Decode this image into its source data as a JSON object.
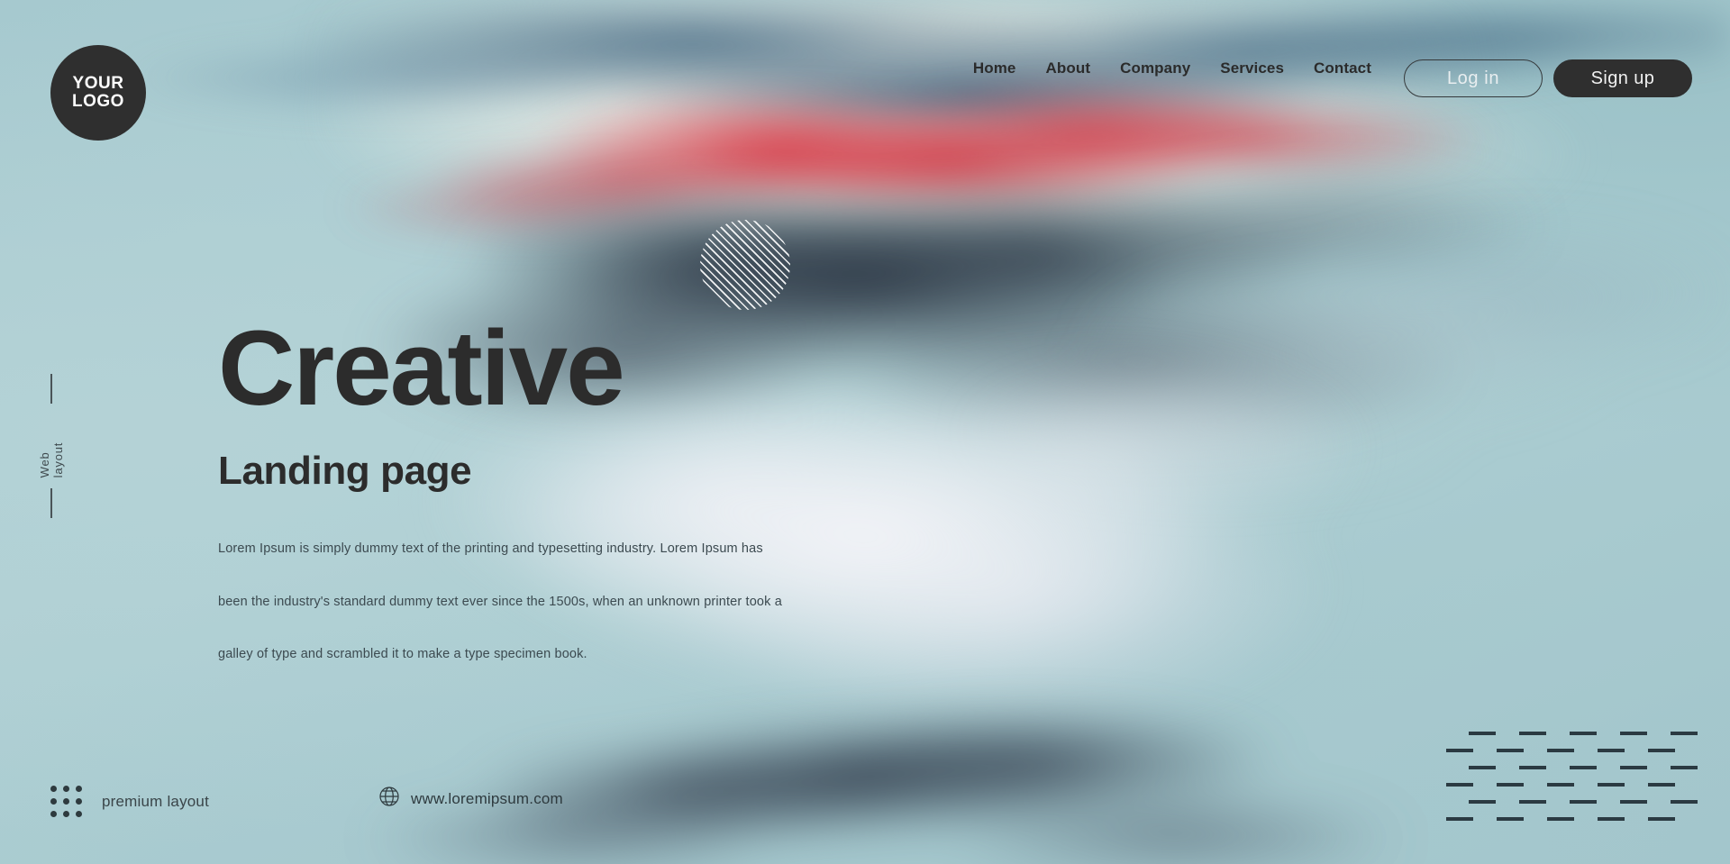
{
  "brand": {
    "logo_line1": "YOUR",
    "logo_line2": "LOGO",
    "logo_bg": "#2f2f2f",
    "logo_text_color": "#ffffff"
  },
  "nav": {
    "items": [
      {
        "label": "Home"
      },
      {
        "label": "About"
      },
      {
        "label": "Company"
      },
      {
        "label": "Services"
      },
      {
        "label": "Contact"
      }
    ]
  },
  "auth": {
    "login_label": "Log in",
    "signup_label": "Sign up",
    "login_style": "outline-pill",
    "signup_style": "filled-pill",
    "signup_bg": "#2f2f2f"
  },
  "side_label": {
    "text": "Web layout"
  },
  "hero": {
    "title": "Creative",
    "subtitle": "Landing page",
    "paragraphs": [
      "Lorem Ipsum is simply dummy text of the printing and typesetting industry. Lorem Ipsum has",
      "been the industry's standard dummy text ever since the 1500s, when an unknown printer took a",
      "galley of type and scrambled it to make a type specimen book."
    ],
    "title_color": "#2c2c2c"
  },
  "footer": {
    "premium_label": "premium layout",
    "website_label": "www.loremipsum.com",
    "globe_icon": "globe-icon",
    "dots_icon": "dot-grid-icon"
  },
  "decorations": {
    "striped_circle": "diagonal-striped-circle",
    "dash_pattern": "staggered-dash-grid",
    "dash_rows": 6,
    "dashes_per_row": 5
  },
  "palette": {
    "base_teal": "#a9cbd1",
    "accent_red": "#d6303e",
    "deep_navy": "#283040",
    "steel_blue": "#2e5674",
    "cream": "#f0f0e8",
    "ink": "#2c2c2c"
  }
}
